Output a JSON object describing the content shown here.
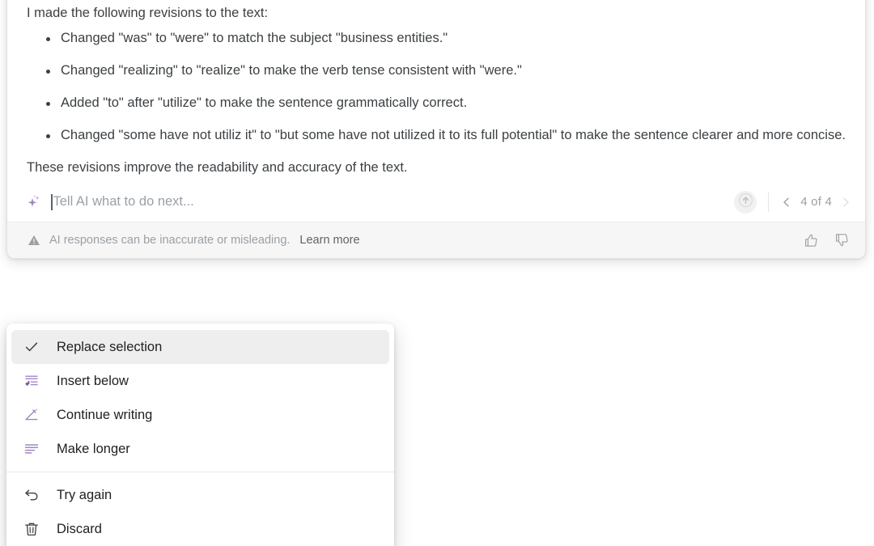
{
  "ai_card": {
    "intro": "I made the following revisions to the text:",
    "revisions": [
      "Changed \"was\" to \"were\" to match the subject \"business entities.\"",
      "Changed \"realizing\" to \"realize\" to make the verb tense consistent with \"were.\"",
      "Added \"to\" after \"utilize\" to make the sentence grammatically correct.",
      "Changed \"some have not utiliz it\" to \"but some have not utilized it to its full potential\" to make the sentence clearer and more concise."
    ],
    "outro": "These revisions improve the readability and accuracy of the text."
  },
  "prompt": {
    "placeholder": "Tell AI what to do next...",
    "value": "",
    "sparkle_icon": "sparkle-icon",
    "submit_icon": "arrow-up-icon",
    "pager": {
      "prev_icon": "chevron-left-icon",
      "next_icon": "chevron-right-icon",
      "count_label": "4 of 4",
      "current": 4,
      "total": 4
    }
  },
  "disclaimer": {
    "warning_icon": "warning-triangle-icon",
    "text": "AI responses can be inaccurate or misleading.",
    "learn_more_label": "Learn more",
    "thumbs_up_icon": "thumbs-up-icon",
    "thumbs_down_icon": "thumbs-down-icon"
  },
  "menu": {
    "groups": [
      {
        "items": [
          {
            "label": "Replace selection",
            "icon": "check-icon",
            "selected": true
          },
          {
            "label": "Insert below",
            "icon": "insert-below-icon",
            "selected": false
          },
          {
            "label": "Continue writing",
            "icon": "pencil-line-icon",
            "selected": false
          },
          {
            "label": "Make longer",
            "icon": "text-lines-icon",
            "selected": false
          }
        ]
      },
      {
        "items": [
          {
            "label": "Try again",
            "icon": "undo-arrow-icon",
            "selected": false
          },
          {
            "label": "Discard",
            "icon": "trash-icon",
            "selected": false
          }
        ]
      }
    ]
  },
  "colors": {
    "accent_purple": "#a285c8",
    "text_primary": "#202124",
    "text_body": "#3c4043",
    "text_muted": "#9aa0a6",
    "card_border": "#e3e3e3",
    "footer_bg": "#f6f6f6",
    "menu_selected_bg": "#eeeeee"
  }
}
